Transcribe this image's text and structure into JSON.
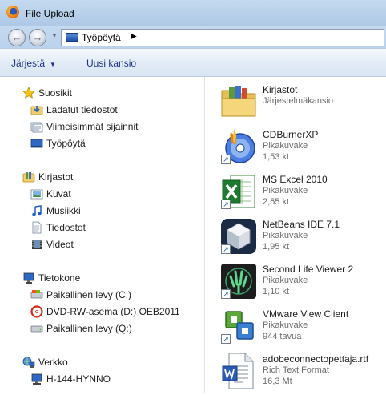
{
  "window": {
    "title": "File Upload"
  },
  "address_bar": {
    "location": "Työpöytä"
  },
  "toolbar": {
    "organize": "Järjestä",
    "new_folder": "Uusi kansio"
  },
  "nav_tree": {
    "favorites": {
      "label": "Suosikit",
      "icon": "star-icon",
      "items": [
        {
          "label": "Ladatut tiedostot",
          "icon": "downloads-folder-icon"
        },
        {
          "label": "Viimeisimmät sijainnit",
          "icon": "recent-places-icon"
        },
        {
          "label": "Työpöytä",
          "icon": "desktop-icon"
        }
      ]
    },
    "libraries": {
      "label": "Kirjastot",
      "icon": "libraries-icon",
      "items": [
        {
          "label": "Kuvat",
          "icon": "pictures-icon"
        },
        {
          "label": "Musiikki",
          "icon": "music-icon"
        },
        {
          "label": "Tiedostot",
          "icon": "documents-icon"
        },
        {
          "label": "Videot",
          "icon": "videos-icon"
        }
      ]
    },
    "computer": {
      "label": "Tietokone",
      "icon": "computer-icon",
      "items": [
        {
          "label": "Paikallinen levy (C:)",
          "icon": "local-disk-icon"
        },
        {
          "label": "DVD-RW-asema (D:) OEB2011",
          "icon": "dvd-drive-icon"
        },
        {
          "label": "Paikallinen levy (Q:)",
          "icon": "local-disk-icon"
        }
      ]
    },
    "network": {
      "label": "Verkko",
      "icon": "network-icon",
      "items": [
        {
          "label": "H-144-HYNNO",
          "icon": "network-computer-icon"
        }
      ]
    }
  },
  "files": [
    {
      "name": "Kirjastot",
      "type": "Järjestelmäkansio",
      "size": "",
      "icon": "libraries-folder-icon",
      "shortcut": false
    },
    {
      "name": "CDBurnerXP",
      "type": "Pikakuvake",
      "size": "1,53 kt",
      "icon": "cdburnerxp-icon",
      "shortcut": true
    },
    {
      "name": "MS Excel 2010",
      "type": "Pikakuvake",
      "size": "2,55 kt",
      "icon": "excel-icon",
      "shortcut": true
    },
    {
      "name": "NetBeans IDE 7.1",
      "type": "Pikakuvake",
      "size": "1,95 kt",
      "icon": "netbeans-icon",
      "shortcut": true
    },
    {
      "name": "Second Life Viewer 2",
      "type": "Pikakuvake",
      "size": "1,10 kt",
      "icon": "second-life-icon",
      "shortcut": true
    },
    {
      "name": "VMware View Client",
      "type": "Pikakuvake",
      "size": "944 tavua",
      "icon": "vmware-icon",
      "shortcut": true
    },
    {
      "name": "adobeconnectopettaja.rtf",
      "type": "Rich Text Format",
      "size": "16,3 Mt",
      "icon": "rtf-document-icon",
      "shortcut": false
    }
  ]
}
